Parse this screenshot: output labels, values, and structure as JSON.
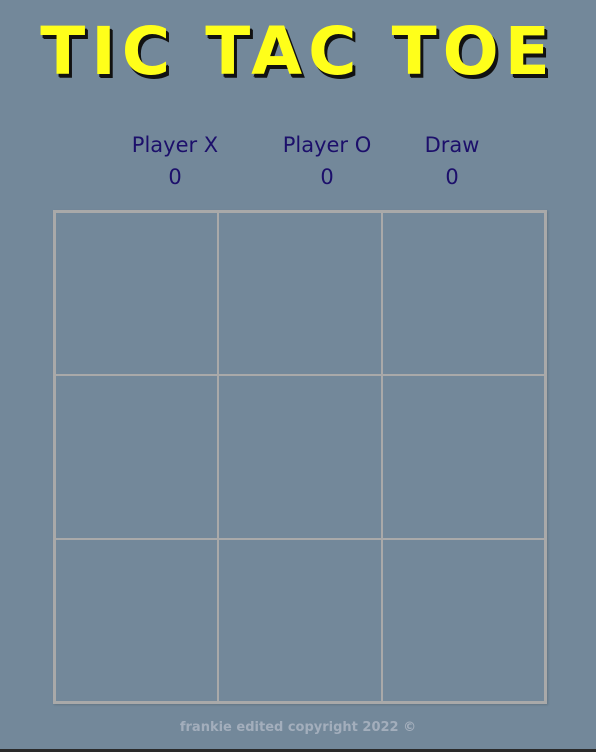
{
  "header": {
    "title": "TIC TAC TOE"
  },
  "scoreboard": {
    "player_x": {
      "label": "Player X",
      "score": "0"
    },
    "player_o": {
      "label": "Player O",
      "score": "0"
    },
    "draw": {
      "label": "Draw",
      "score": "0"
    }
  },
  "board": {
    "cells": [
      "",
      "",
      "",
      "",
      "",
      "",
      "",
      "",
      ""
    ]
  },
  "footer": {
    "text": "frankie edited copyright 2022 ©"
  },
  "colors": {
    "background": "#73889a",
    "title": "#ffff1a",
    "score_text": "#1c0f6b",
    "grid_lines": "#a9a9a9",
    "footer_text": "#a3aebc"
  }
}
